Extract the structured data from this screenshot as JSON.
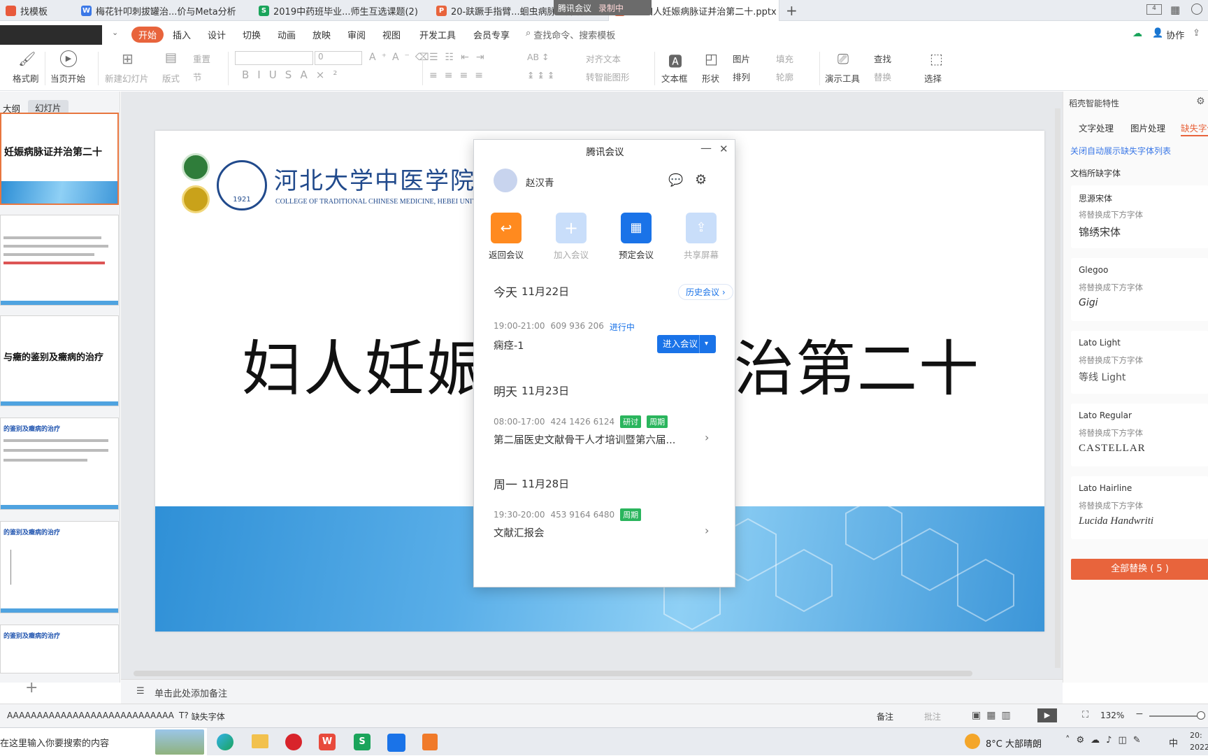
{
  "tabs": [
    {
      "label": "找模板",
      "icon": "template-icon"
    },
    {
      "label": "梅花针叩刺拔罐治...价与Meta分析",
      "icon": "writer-doc-icon"
    },
    {
      "label": "2019中药班毕业...师生互选课题(2)",
      "icon": "sheet-doc-icon"
    },
    {
      "label": "20-趺蹶手指臂...蛔虫病脉证并治",
      "icon": "ppt-doc-icon"
    },
    {
      "label": "21-妇人妊娠病脉证并治第二十.pptx",
      "icon": "ppt-doc-icon"
    }
  ],
  "floating": {
    "meeting": "腾讯会议",
    "recording": "录制中"
  },
  "menu": {
    "items": [
      "开始",
      "插入",
      "设计",
      "切换",
      "动画",
      "放映",
      "审阅",
      "视图",
      "开发工具",
      "会员专享"
    ],
    "search": "查找命令、搜索模板",
    "collab": "协作"
  },
  "ribbon": {
    "format_brush": "格式刷",
    "from_current": "当页开始",
    "new_slide": "新建幻灯片",
    "layout": "版式",
    "reset": "重置",
    "section": "节",
    "font_size": "0",
    "align_text": "对齐文本",
    "smart_shape": "转智能图形",
    "textbox": "文本框",
    "shape": "形状",
    "picture": "图片",
    "fill": "填充",
    "arrange": "排列",
    "outline": "轮廓",
    "presenter": "演示工具",
    "find": "查找",
    "replace": "替换",
    "select": "选择"
  },
  "left_panel": {
    "tab_outline": "大纲",
    "tab_slides": "幻灯片"
  },
  "thumbnails": [
    {
      "title": "妊娠病脉证并治第二十"
    },
    {
      "title": ""
    },
    {
      "title": "与癥的鉴别及癥病的治疗"
    },
    {
      "title": "的鉴别及癥病的治疗"
    },
    {
      "title": "的鉴别及癥病的治疗"
    },
    {
      "title": "的鉴别及癥病的治疗"
    }
  ],
  "slide": {
    "title": "妇人妊娠病脉证并治第二十",
    "university_cn": "河北大学中医学院",
    "university_en": "COLLEGE OF TRADITIONAL CHINESE MEDICINE, HEBEI UNIVERSITY",
    "seal_year": "1921"
  },
  "notes_placeholder": "单击此处添加备注",
  "meeting": {
    "title": "腾讯会议",
    "user": "赵汉青",
    "actions": [
      {
        "label": "返回会议",
        "color": "#ff8a1f",
        "enabled": true
      },
      {
        "label": "加入会议",
        "color": "#c9defa",
        "enabled": false
      },
      {
        "label": "预定会议",
        "color": "#1a73e8",
        "enabled": true
      },
      {
        "label": "共享屏幕",
        "color": "#c9defa",
        "enabled": false
      }
    ],
    "history": "历史会议",
    "days": [
      {
        "day": "今天",
        "date": "11月22日",
        "time": "19:00-21:00",
        "id": "609 936 206",
        "status": "进行中",
        "tags": [],
        "name": "痫痉-1",
        "action": "进入会议"
      },
      {
        "day": "明天",
        "date": "11月23日",
        "time": "08:00-17:00",
        "id": "424 1426 6124",
        "status": "",
        "tags": [
          "研讨",
          "周期"
        ],
        "name": "第二届医史文献骨干人才培训暨第六届...",
        "action": ""
      },
      {
        "day": "周一",
        "date": "11月28日",
        "time": "19:30-20:00",
        "id": "453 9164 6480",
        "status": "",
        "tags": [
          "周期"
        ],
        "name": "文献汇报会",
        "action": ""
      }
    ]
  },
  "right_panel": {
    "header": "稻壳智能特性",
    "tabs": [
      "文字处理",
      "图片处理",
      "缺失字体"
    ],
    "close_link": "关闭自动展示缺失字体列表",
    "section": "文档所缺字体",
    "replace_with": "将替换成下方字体",
    "fonts": [
      {
        "missing": "思源宋体",
        "replacement": "锦绣宋体"
      },
      {
        "missing": "Glegoo",
        "replacement": "Gigi"
      },
      {
        "missing": "Lato Light",
        "replacement": "等线 Light"
      },
      {
        "missing": "Lato Regular",
        "replacement": "CASTELLAR"
      },
      {
        "missing": "Lato Hairline",
        "replacement": "Lucida Handwriti"
      }
    ],
    "replace_all": "全部替换 ( 5 )"
  },
  "status": {
    "font_sample": "AAAAAAAAAAAAAAAAAAAAAAAAAAAA",
    "missing_font": "缺失字体",
    "notes": "备注",
    "comments": "批注",
    "zoom": "132%"
  },
  "taskbar": {
    "search_placeholder": "在这里输入你要搜索的内容",
    "weather": "8°C 大部晴朗",
    "ime": "中",
    "time": "20:",
    "date": "2022"
  }
}
